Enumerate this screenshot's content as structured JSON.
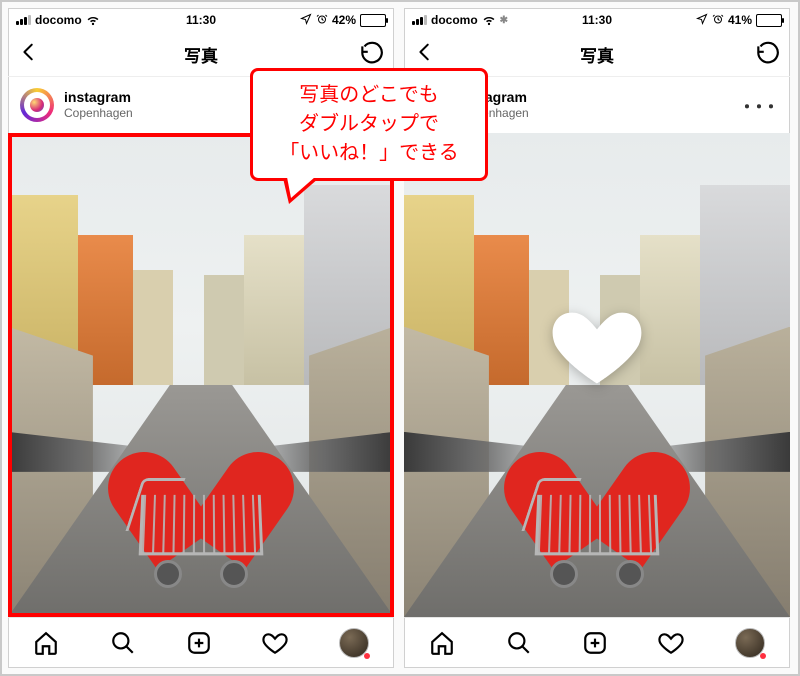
{
  "callout": {
    "line1": "写真のどこでも",
    "line2": "ダブルタップで",
    "line3": "「いいね！」できる"
  },
  "phones": {
    "left": {
      "status": {
        "carrier": "docomo",
        "time": "11:30",
        "battery_pct": "42%",
        "battery_fill": 42
      },
      "nav": {
        "title": "写真"
      },
      "post": {
        "username": "instagram",
        "location": "Copenhagen"
      },
      "highlight_frame": true,
      "show_like_heart": false
    },
    "right": {
      "status": {
        "carrier": "docomo",
        "time": "11:30",
        "battery_pct": "41%",
        "battery_fill": 41
      },
      "nav": {
        "title": "写真"
      },
      "post": {
        "username": "instagram",
        "location": "Copenhagen"
      },
      "highlight_frame": false,
      "show_like_heart": true
    }
  },
  "tabs": [
    "home",
    "search",
    "create",
    "activity",
    "profile"
  ],
  "icons": {
    "back": "‹",
    "more": "･･･",
    "location_arrow": "➤",
    "alarm": "⏰"
  }
}
